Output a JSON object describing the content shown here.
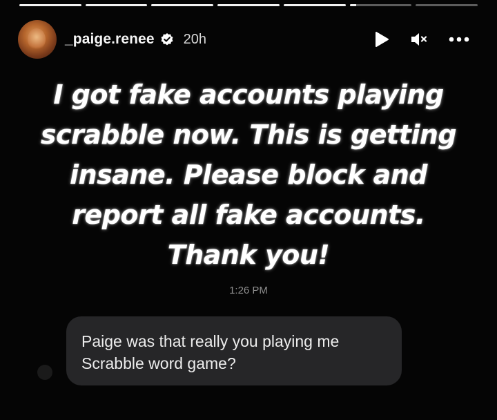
{
  "story": {
    "progress": [
      1,
      1,
      1,
      1,
      1,
      0.1,
      0
    ],
    "user": {
      "username": "_paige.renee",
      "verified": true,
      "time_ago": "20h"
    },
    "controls": {
      "play": "play-icon",
      "mute": "muted-speaker-icon",
      "more": "more-options-icon"
    },
    "text": "I got fake accounts playing\nscrabble now. This is getting\ninsane. Please block and\nreport all fake accounts.\nThank you!",
    "message": {
      "timestamp": "1:26 PM",
      "text": "Paige was that really you playing me\nScrabble word game?"
    }
  },
  "colors": {
    "background": "#050505",
    "bubble": "#262628",
    "progress_fill": "#f2f2f2",
    "progress_track": "rgba(255,255,255,0.35)",
    "timestamp": "#8f8f8f"
  }
}
